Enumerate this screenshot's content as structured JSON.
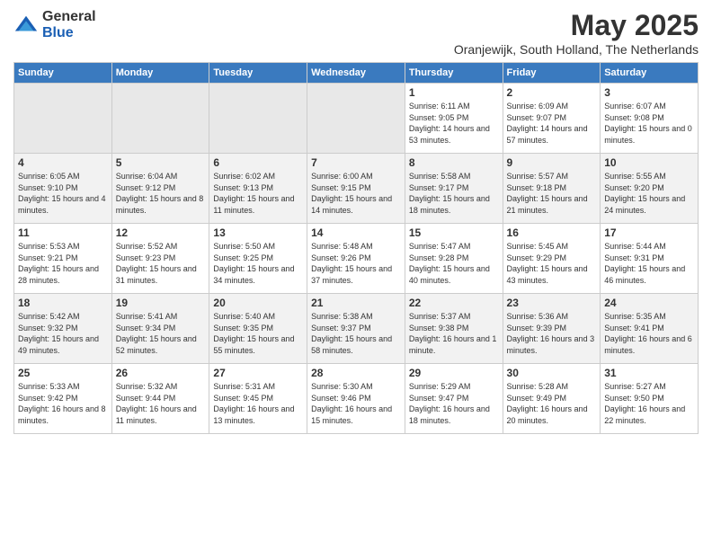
{
  "header": {
    "logo_general": "General",
    "logo_blue": "Blue",
    "month": "May 2025",
    "location": "Oranjewijk, South Holland, The Netherlands"
  },
  "days_of_week": [
    "Sunday",
    "Monday",
    "Tuesday",
    "Wednesday",
    "Thursday",
    "Friday",
    "Saturday"
  ],
  "weeks": [
    [
      {
        "day": "",
        "sunrise": "",
        "sunset": "",
        "daylight": "",
        "empty": true
      },
      {
        "day": "",
        "sunrise": "",
        "sunset": "",
        "daylight": "",
        "empty": true
      },
      {
        "day": "",
        "sunrise": "",
        "sunset": "",
        "daylight": "",
        "empty": true
      },
      {
        "day": "",
        "sunrise": "",
        "sunset": "",
        "daylight": "",
        "empty": true
      },
      {
        "day": "1",
        "sunrise": "Sunrise: 6:11 AM",
        "sunset": "Sunset: 9:05 PM",
        "daylight": "Daylight: 14 hours and 53 minutes.",
        "empty": false
      },
      {
        "day": "2",
        "sunrise": "Sunrise: 6:09 AM",
        "sunset": "Sunset: 9:07 PM",
        "daylight": "Daylight: 14 hours and 57 minutes.",
        "empty": false
      },
      {
        "day": "3",
        "sunrise": "Sunrise: 6:07 AM",
        "sunset": "Sunset: 9:08 PM",
        "daylight": "Daylight: 15 hours and 0 minutes.",
        "empty": false
      }
    ],
    [
      {
        "day": "4",
        "sunrise": "Sunrise: 6:05 AM",
        "sunset": "Sunset: 9:10 PM",
        "daylight": "Daylight: 15 hours and 4 minutes.",
        "empty": false
      },
      {
        "day": "5",
        "sunrise": "Sunrise: 6:04 AM",
        "sunset": "Sunset: 9:12 PM",
        "daylight": "Daylight: 15 hours and 8 minutes.",
        "empty": false
      },
      {
        "day": "6",
        "sunrise": "Sunrise: 6:02 AM",
        "sunset": "Sunset: 9:13 PM",
        "daylight": "Daylight: 15 hours and 11 minutes.",
        "empty": false
      },
      {
        "day": "7",
        "sunrise": "Sunrise: 6:00 AM",
        "sunset": "Sunset: 9:15 PM",
        "daylight": "Daylight: 15 hours and 14 minutes.",
        "empty": false
      },
      {
        "day": "8",
        "sunrise": "Sunrise: 5:58 AM",
        "sunset": "Sunset: 9:17 PM",
        "daylight": "Daylight: 15 hours and 18 minutes.",
        "empty": false
      },
      {
        "day": "9",
        "sunrise": "Sunrise: 5:57 AM",
        "sunset": "Sunset: 9:18 PM",
        "daylight": "Daylight: 15 hours and 21 minutes.",
        "empty": false
      },
      {
        "day": "10",
        "sunrise": "Sunrise: 5:55 AM",
        "sunset": "Sunset: 9:20 PM",
        "daylight": "Daylight: 15 hours and 24 minutes.",
        "empty": false
      }
    ],
    [
      {
        "day": "11",
        "sunrise": "Sunrise: 5:53 AM",
        "sunset": "Sunset: 9:21 PM",
        "daylight": "Daylight: 15 hours and 28 minutes.",
        "empty": false
      },
      {
        "day": "12",
        "sunrise": "Sunrise: 5:52 AM",
        "sunset": "Sunset: 9:23 PM",
        "daylight": "Daylight: 15 hours and 31 minutes.",
        "empty": false
      },
      {
        "day": "13",
        "sunrise": "Sunrise: 5:50 AM",
        "sunset": "Sunset: 9:25 PM",
        "daylight": "Daylight: 15 hours and 34 minutes.",
        "empty": false
      },
      {
        "day": "14",
        "sunrise": "Sunrise: 5:48 AM",
        "sunset": "Sunset: 9:26 PM",
        "daylight": "Daylight: 15 hours and 37 minutes.",
        "empty": false
      },
      {
        "day": "15",
        "sunrise": "Sunrise: 5:47 AM",
        "sunset": "Sunset: 9:28 PM",
        "daylight": "Daylight: 15 hours and 40 minutes.",
        "empty": false
      },
      {
        "day": "16",
        "sunrise": "Sunrise: 5:45 AM",
        "sunset": "Sunset: 9:29 PM",
        "daylight": "Daylight: 15 hours and 43 minutes.",
        "empty": false
      },
      {
        "day": "17",
        "sunrise": "Sunrise: 5:44 AM",
        "sunset": "Sunset: 9:31 PM",
        "daylight": "Daylight: 15 hours and 46 minutes.",
        "empty": false
      }
    ],
    [
      {
        "day": "18",
        "sunrise": "Sunrise: 5:42 AM",
        "sunset": "Sunset: 9:32 PM",
        "daylight": "Daylight: 15 hours and 49 minutes.",
        "empty": false
      },
      {
        "day": "19",
        "sunrise": "Sunrise: 5:41 AM",
        "sunset": "Sunset: 9:34 PM",
        "daylight": "Daylight: 15 hours and 52 minutes.",
        "empty": false
      },
      {
        "day": "20",
        "sunrise": "Sunrise: 5:40 AM",
        "sunset": "Sunset: 9:35 PM",
        "daylight": "Daylight: 15 hours and 55 minutes.",
        "empty": false
      },
      {
        "day": "21",
        "sunrise": "Sunrise: 5:38 AM",
        "sunset": "Sunset: 9:37 PM",
        "daylight": "Daylight: 15 hours and 58 minutes.",
        "empty": false
      },
      {
        "day": "22",
        "sunrise": "Sunrise: 5:37 AM",
        "sunset": "Sunset: 9:38 PM",
        "daylight": "Daylight: 16 hours and 1 minute.",
        "empty": false
      },
      {
        "day": "23",
        "sunrise": "Sunrise: 5:36 AM",
        "sunset": "Sunset: 9:39 PM",
        "daylight": "Daylight: 16 hours and 3 minutes.",
        "empty": false
      },
      {
        "day": "24",
        "sunrise": "Sunrise: 5:35 AM",
        "sunset": "Sunset: 9:41 PM",
        "daylight": "Daylight: 16 hours and 6 minutes.",
        "empty": false
      }
    ],
    [
      {
        "day": "25",
        "sunrise": "Sunrise: 5:33 AM",
        "sunset": "Sunset: 9:42 PM",
        "daylight": "Daylight: 16 hours and 8 minutes.",
        "empty": false
      },
      {
        "day": "26",
        "sunrise": "Sunrise: 5:32 AM",
        "sunset": "Sunset: 9:44 PM",
        "daylight": "Daylight: 16 hours and 11 minutes.",
        "empty": false
      },
      {
        "day": "27",
        "sunrise": "Sunrise: 5:31 AM",
        "sunset": "Sunset: 9:45 PM",
        "daylight": "Daylight: 16 hours and 13 minutes.",
        "empty": false
      },
      {
        "day": "28",
        "sunrise": "Sunrise: 5:30 AM",
        "sunset": "Sunset: 9:46 PM",
        "daylight": "Daylight: 16 hours and 15 minutes.",
        "empty": false
      },
      {
        "day": "29",
        "sunrise": "Sunrise: 5:29 AM",
        "sunset": "Sunset: 9:47 PM",
        "daylight": "Daylight: 16 hours and 18 minutes.",
        "empty": false
      },
      {
        "day": "30",
        "sunrise": "Sunrise: 5:28 AM",
        "sunset": "Sunset: 9:49 PM",
        "daylight": "Daylight: 16 hours and 20 minutes.",
        "empty": false
      },
      {
        "day": "31",
        "sunrise": "Sunrise: 5:27 AM",
        "sunset": "Sunset: 9:50 PM",
        "daylight": "Daylight: 16 hours and 22 minutes.",
        "empty": false
      }
    ]
  ]
}
